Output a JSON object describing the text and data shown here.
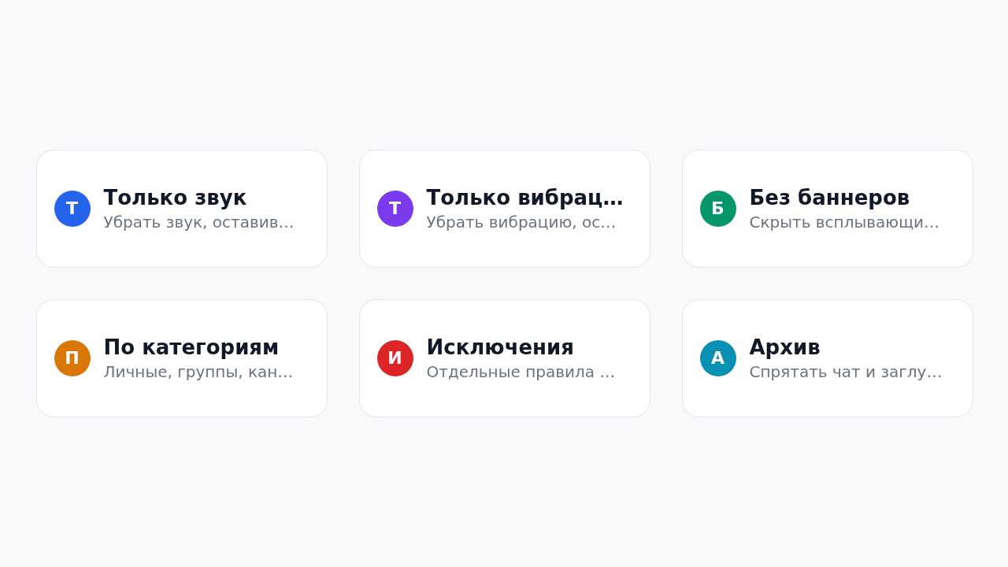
{
  "cards": [
    {
      "initial": "Т",
      "color": "#2563eb",
      "title": "Только звук",
      "subtitle": "Убрать звук, оставив…"
    },
    {
      "initial": "Т",
      "color": "#7c3aed",
      "title": "Только вибрац…",
      "subtitle": "Убрать вибрацию, ос…"
    },
    {
      "initial": "Б",
      "color": "#059669",
      "title": "Без баннеров",
      "subtitle": "Скрыть всплывающи…"
    },
    {
      "initial": "П",
      "color": "#d97706",
      "title": "По категориям",
      "subtitle": "Личные, группы, кан…"
    },
    {
      "initial": "И",
      "color": "#dc2626",
      "title": "Исключения",
      "subtitle": "Отдельные правила …"
    },
    {
      "initial": "А",
      "color": "#0891b2",
      "title": "Архив",
      "subtitle": "Спрятать чат и заглу…"
    }
  ]
}
